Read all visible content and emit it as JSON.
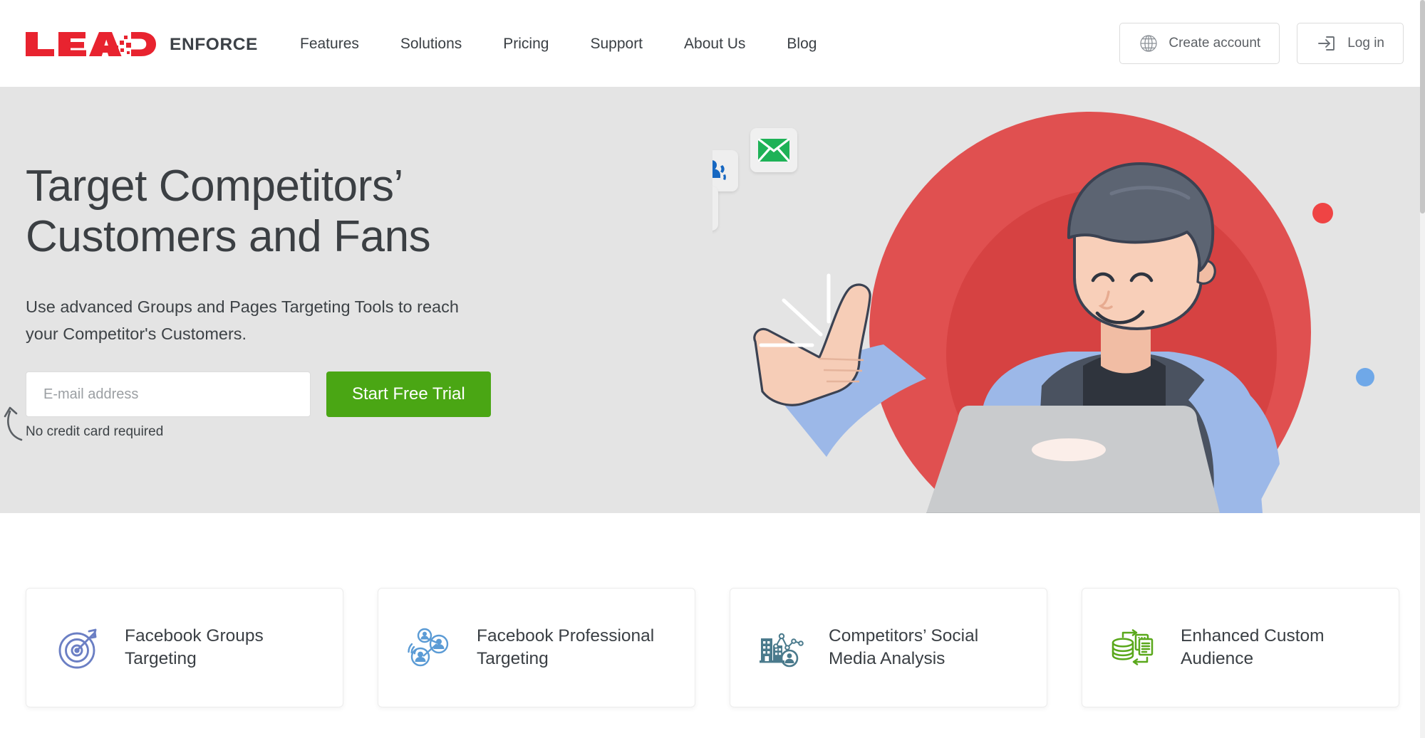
{
  "brand": {
    "logo_lead": "LEAD",
    "logo_enforce": "ENFORCE",
    "red": "#e8232f",
    "dark": "#3c4147"
  },
  "nav": {
    "items": [
      {
        "label": "Features"
      },
      {
        "label": "Solutions"
      },
      {
        "label": "Pricing"
      },
      {
        "label": "Support"
      },
      {
        "label": "About Us"
      },
      {
        "label": "Blog"
      }
    ]
  },
  "header_actions": {
    "create_account": {
      "label": "Create account",
      "icon": "globe-icon"
    },
    "log_in": {
      "label": "Log in",
      "icon": "login-icon"
    }
  },
  "hero": {
    "title_line1": "Target Competitors’",
    "title_line2": "Customers and Fans",
    "subtitle_line1": "Use advanced Groups and Pages Targeting Tools to reach",
    "subtitle_line2": "your Competitor's Customers.",
    "email_placeholder": "E-mail address",
    "email_value": "",
    "cta_label": "Start Free Trial",
    "no_credit_card": "No credit card required",
    "background_color": "#e4e4e4",
    "cta_color": "#4aa614",
    "illustration": {
      "badges": [
        {
          "name": "people-badge-icon",
          "color": "#1667c1"
        },
        {
          "name": "envelope-badge-icon",
          "color": "#1eb257"
        },
        {
          "name": "phone-badge-icon",
          "color": "#e8453c"
        }
      ],
      "accent_dot_red": "#ef4444",
      "accent_dot_blue": "#6fa8e8",
      "circle_color": "#e05050"
    }
  },
  "cards": [
    {
      "label_line1": "Facebook Groups",
      "label_line2": "Targeting",
      "icon": "target-arrow-icon",
      "color": "#6b7fc4"
    },
    {
      "label_line1": "Facebook Professional",
      "label_line2": "Targeting",
      "icon": "people-network-icon",
      "color": "#5b9bd5"
    },
    {
      "label_line1": "Competitors’ Social",
      "label_line2": "Media Analysis",
      "icon": "building-chart-icon",
      "color": "#4a7a8c"
    },
    {
      "label_line1": "Enhanced Custom",
      "label_line2": "Audience",
      "icon": "database-sync-icon",
      "color": "#5aa81b"
    }
  ]
}
